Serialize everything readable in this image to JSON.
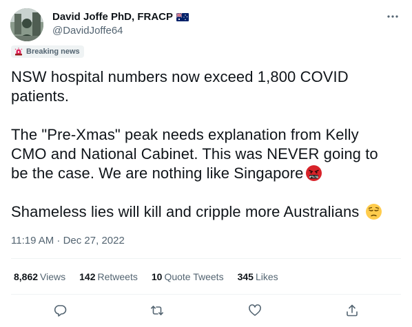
{
  "author": {
    "name": "David Joffe PhD, FRACP",
    "handle": "@DavidJoffe64",
    "flag_icon": "australia-flag-icon",
    "avatar_icon": "profile-photo"
  },
  "label": {
    "icon": "siren-icon",
    "text": "Breaking news"
  },
  "tweet": {
    "line1": "NSW hospital numbers now exceed 1,800 COVID patients.",
    "line2": "The \"Pre-Xmas\" peak needs explanation from Kelly CMO and National Cabinet. This was NEVER going to be the case. We are nothing like Singapore",
    "line2_emoji": "face-with-symbols-on-mouth",
    "line3": "Shameless lies will kill and cripple more Australians ",
    "line3_emoji": "pensive-face"
  },
  "timestamp": "11:19 AM · Dec 27, 2022",
  "stats": [
    {
      "value": "8,862",
      "label": "Views"
    },
    {
      "value": "142",
      "label": "Retweets"
    },
    {
      "value": "10",
      "label": "Quote Tweets"
    },
    {
      "value": "345",
      "label": "Likes"
    }
  ],
  "actions": [
    "reply-icon",
    "retweet-icon",
    "like-icon",
    "share-icon"
  ],
  "colors": {
    "text": "#0f1419",
    "secondary": "#536471",
    "divider": "#eff3f4"
  }
}
